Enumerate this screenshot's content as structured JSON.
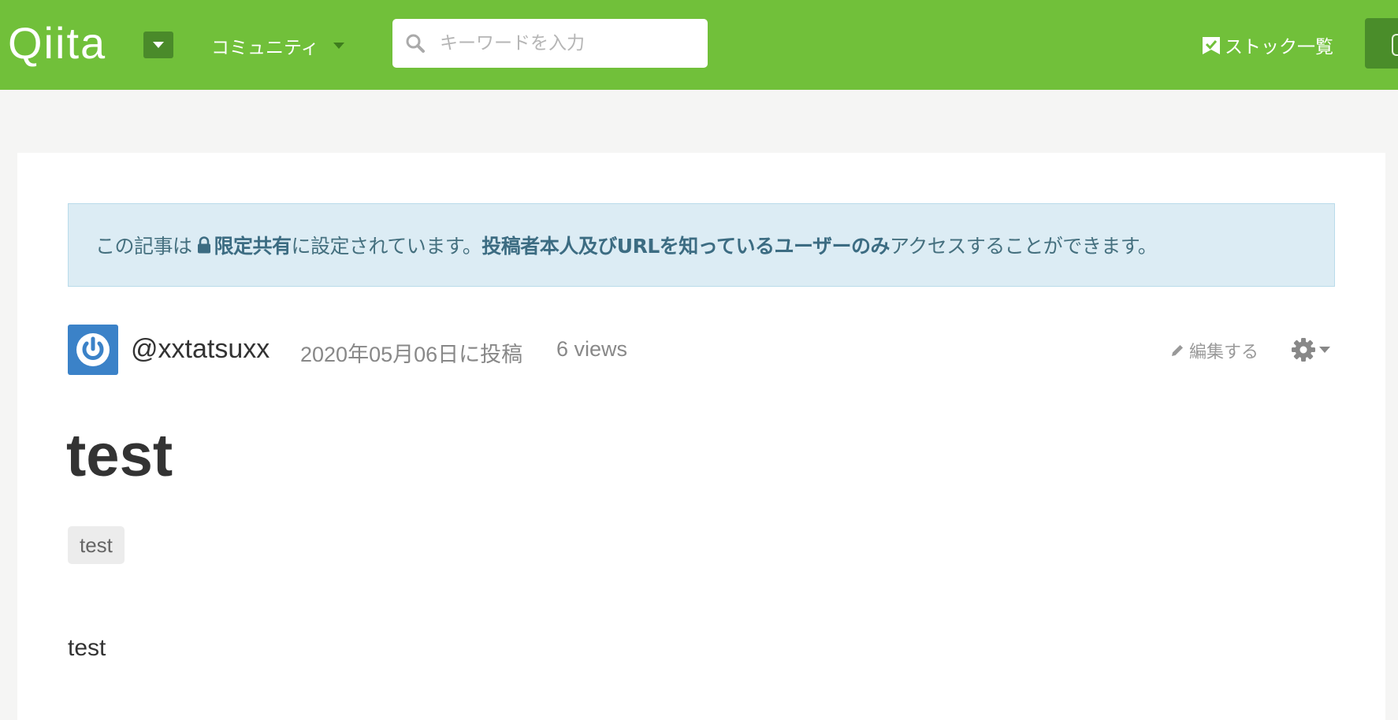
{
  "header": {
    "logo": "Qiita",
    "community_label": "コミュニティ",
    "search": {
      "placeholder": "キーワードを入力",
      "value": ""
    },
    "stock_label": "ストック一覧",
    "brand_color": "#71c03a"
  },
  "notice": {
    "prefix": "この記事は",
    "limited": "限定共有",
    "middle": "に設定されています。",
    "audience": "投稿者本人及びURLを知っているユーザーのみ",
    "suffix": "アクセスすることができます。"
  },
  "article": {
    "author": "@xxtatsuxx",
    "posted_at": "2020年05月06日に投稿",
    "views": "6 views",
    "edit_label": "編集する",
    "title": "test",
    "tags": [
      "test"
    ],
    "body": "test"
  }
}
